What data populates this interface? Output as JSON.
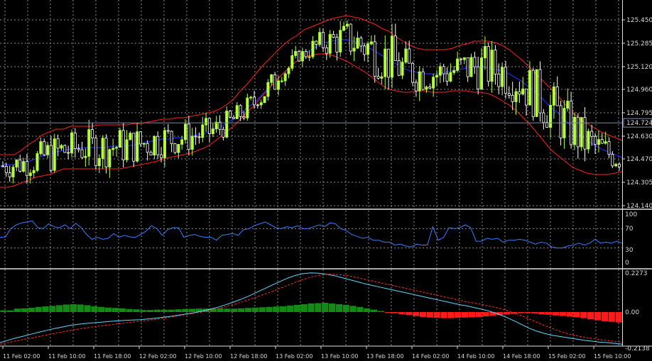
{
  "colors": {
    "background": "#000000",
    "grid": "#8a8a8a",
    "bull_candle": "#b5ff3a",
    "bear_candle": "#ffffff",
    "bb_upper": "#ff1e1e",
    "bb_middle": "#1a2dff",
    "bb_lower": "#ff1e1e",
    "rsi": "#3a7cff",
    "macd_pos_hist": "#138a13",
    "macd_neg_hist": "#ff1a1a",
    "macd_main": "#5fd8ff",
    "macd_signal": "#ff2a2a",
    "current_price_line": "#7a86c8"
  },
  "price_axis": {
    "ticks": [
      "125.450",
      "125.285",
      "125.120",
      "124.960",
      "124.795",
      "124.630",
      "124.470",
      "124.305",
      "124.140"
    ],
    "current_price_label": "124.724",
    "current_price": 124.724
  },
  "rsi_axis": {
    "ticks": [
      "100",
      "70",
      "30",
      "0"
    ]
  },
  "macd_axis": {
    "ticks": [
      "0.2273",
      "0.00",
      "-0.2138"
    ]
  },
  "time_axis": {
    "labels": [
      "11 Feb 02:00",
      "11 Feb 10:00",
      "11 Feb 18:00",
      "12 Feb 02:00",
      "12 Feb 10:00",
      "12 Feb 18:00",
      "13 Feb 02:00",
      "13 Feb 10:00",
      "13 Feb 18:00",
      "14 Feb 02:00",
      "14 Feb 10:00",
      "14 Feb 18:00",
      "15 Feb 02:00",
      "15 Feb 10:00"
    ]
  },
  "chart_data": [
    {
      "type": "candlestick",
      "title": "",
      "price_range": [
        124.14,
        125.53
      ],
      "bb_upper": [
        124.5,
        124.5,
        124.5,
        124.53,
        124.57,
        124.6,
        124.64,
        124.66,
        124.68,
        124.68,
        124.7,
        124.7,
        124.7,
        124.7,
        124.71,
        124.71,
        124.71,
        124.71,
        124.71,
        124.72,
        124.72,
        124.73,
        124.74,
        124.75,
        124.75,
        124.76,
        124.76,
        124.77,
        124.78,
        124.79,
        124.8,
        124.82,
        124.85,
        124.89,
        124.95,
        125.0,
        125.06,
        125.12,
        125.17,
        125.22,
        125.27,
        125.31,
        125.34,
        125.38,
        125.4,
        125.42,
        125.44,
        125.46,
        125.47,
        125.48,
        125.47,
        125.46,
        125.44,
        125.42,
        125.39,
        125.37,
        125.33,
        125.3,
        125.27,
        125.25,
        125.24,
        125.24,
        125.24,
        125.24,
        125.25,
        125.27,
        125.28,
        125.3,
        125.3,
        125.3,
        125.29,
        125.27,
        125.24,
        125.2,
        125.16,
        125.11,
        125.06,
        125.01,
        124.96,
        124.91,
        124.85,
        124.8,
        124.75,
        124.72,
        124.69,
        124.66,
        124.64,
        124.62,
        124.6
      ],
      "bb_middle": [
        124.42,
        124.43,
        124.43,
        124.44,
        124.45,
        124.47,
        124.49,
        124.5,
        124.52,
        124.53,
        124.54,
        124.55,
        124.55,
        124.55,
        124.55,
        124.55,
        124.56,
        124.56,
        124.56,
        124.57,
        124.58,
        124.59,
        124.6,
        124.61,
        124.61,
        124.62,
        124.62,
        124.63,
        124.64,
        124.65,
        124.67,
        124.69,
        124.72,
        124.75,
        124.79,
        124.83,
        124.87,
        124.92,
        124.97,
        125.02,
        125.07,
        125.12,
        125.16,
        125.2,
        125.24,
        125.27,
        125.29,
        125.3,
        125.31,
        125.31,
        125.3,
        125.28,
        125.26,
        125.23,
        125.2,
        125.17,
        125.14,
        125.11,
        125.09,
        125.08,
        125.07,
        125.07,
        125.07,
        125.08,
        125.09,
        125.1,
        125.11,
        125.12,
        125.12,
        125.11,
        125.1,
        125.09,
        125.07,
        125.04,
        125.01,
        124.97,
        124.93,
        124.88,
        124.83,
        124.79,
        124.74,
        124.69,
        124.64,
        124.6,
        124.57,
        124.54,
        124.52,
        124.5,
        124.48
      ],
      "bb_lower": [
        124.27,
        124.27,
        124.28,
        124.3,
        124.32,
        124.34,
        124.35,
        124.36,
        124.38,
        124.4,
        124.4,
        124.4,
        124.4,
        124.4,
        124.4,
        124.4,
        124.4,
        124.4,
        124.41,
        124.42,
        124.43,
        124.44,
        124.45,
        124.47,
        124.48,
        124.49,
        124.5,
        124.51,
        124.53,
        124.55,
        124.58,
        124.62,
        124.66,
        124.7,
        124.75,
        124.8,
        124.85,
        124.91,
        124.96,
        125.02,
        125.07,
        125.12,
        125.16,
        125.19,
        125.2,
        125.21,
        125.21,
        125.2,
        125.18,
        125.16,
        125.13,
        125.1,
        125.07,
        125.03,
        124.99,
        124.96,
        124.95,
        124.94,
        124.94,
        124.95,
        124.95,
        124.94,
        124.94,
        124.94,
        124.95,
        124.95,
        124.95,
        124.94,
        124.94,
        124.93,
        124.91,
        124.88,
        124.85,
        124.81,
        124.76,
        124.71,
        124.65,
        124.59,
        124.53,
        124.49,
        124.45,
        124.41,
        124.39,
        124.37,
        124.36,
        124.36,
        124.36,
        124.37,
        124.38
      ]
    },
    {
      "type": "line",
      "title": "",
      "ylim": [
        0,
        100
      ],
      "levels": [
        70,
        30
      ],
      "values": [
        52,
        53,
        70,
        78,
        82,
        84,
        86,
        72,
        70,
        80,
        74,
        72,
        78,
        70,
        81,
        72,
        58,
        48,
        52,
        48,
        50,
        60,
        52,
        56,
        53,
        52,
        58,
        65,
        76,
        70,
        56,
        68,
        72,
        72,
        52,
        56,
        58,
        54,
        52,
        52,
        46,
        56,
        58,
        60,
        56,
        68,
        70,
        76,
        80,
        84,
        78,
        72,
        70,
        74,
        72,
        76,
        70,
        70,
        74,
        78,
        74,
        82,
        80,
        70,
        66,
        58,
        54,
        50,
        52,
        46,
        46,
        42,
        42,
        36,
        38,
        34,
        32,
        38,
        36,
        36,
        74,
        46,
        52,
        72,
        70,
        72,
        78,
        72,
        44,
        44,
        50,
        48,
        50,
        42,
        46,
        46,
        48,
        46,
        42,
        38,
        42,
        40,
        32,
        30,
        30,
        34,
        36,
        40,
        36,
        40,
        48,
        40,
        42,
        40,
        44,
        40
      ]
    },
    {
      "type": "bar",
      "title": "",
      "ylim": [
        -0.2138,
        0.2273
      ],
      "histogram": [
        0.01,
        0.01,
        0.02,
        0.022,
        0.025,
        0.03,
        0.033,
        0.036,
        0.04,
        0.044,
        0.046,
        0.044,
        0.04,
        0.034,
        0.03,
        0.026,
        0.024,
        0.022,
        0.018,
        0.016,
        0.012,
        0.012,
        0.014,
        0.014,
        0.014,
        0.016,
        0.018,
        0.019,
        0.02,
        0.02,
        0.02,
        0.022,
        0.02,
        0.02,
        0.022,
        0.024,
        0.026,
        0.028,
        0.03,
        0.032,
        0.034,
        0.038,
        0.042,
        0.046,
        0.05,
        0.052,
        0.054,
        0.05,
        0.046,
        0.042,
        0.036,
        0.03,
        0.022,
        0.014,
        0.006,
        -0.002,
        -0.008,
        -0.014,
        -0.02,
        -0.026,
        -0.032,
        -0.036,
        -0.038,
        -0.04,
        -0.04,
        -0.038,
        -0.036,
        -0.034,
        -0.032,
        -0.028,
        -0.024,
        -0.02,
        -0.016,
        -0.012,
        -0.008,
        -0.008,
        -0.01,
        -0.014,
        -0.018,
        -0.022,
        -0.026,
        -0.03,
        -0.034,
        -0.04,
        -0.048,
        -0.054,
        -0.06,
        -0.064,
        -0.068
      ],
      "series": [
        {
          "values": [
            -0.2,
            -0.185,
            -0.17,
            -0.158,
            -0.145,
            -0.132,
            -0.12,
            -0.108,
            -0.098,
            -0.088,
            -0.08,
            -0.075,
            -0.07,
            -0.066,
            -0.062,
            -0.058,
            -0.055,
            -0.052,
            -0.05,
            -0.045,
            -0.04,
            -0.034,
            -0.028,
            -0.02,
            -0.012,
            -0.004,
            0.006,
            0.016,
            0.028,
            0.042,
            0.058,
            0.075,
            0.094,
            0.115,
            0.136,
            0.158,
            0.178,
            0.198,
            0.214,
            0.224,
            0.228,
            0.226,
            0.22,
            0.212,
            0.2,
            0.188,
            0.176,
            0.164,
            0.154,
            0.144,
            0.134,
            0.124,
            0.114,
            0.104,
            0.094,
            0.084,
            0.074,
            0.064,
            0.054,
            0.044,
            0.036,
            0.026,
            0.016,
            0.004,
            -0.012,
            -0.032,
            -0.055,
            -0.08,
            -0.105,
            -0.125,
            -0.14,
            -0.152,
            -0.16,
            -0.168,
            -0.176,
            -0.184,
            -0.19,
            -0.196,
            -0.2,
            -0.205,
            -0.21
          ]
        },
        {
          "values": [
            -0.21,
            -0.2,
            -0.19,
            -0.18,
            -0.17,
            -0.16,
            -0.15,
            -0.14,
            -0.13,
            -0.12,
            -0.112,
            -0.104,
            -0.097,
            -0.09,
            -0.084,
            -0.078,
            -0.072,
            -0.066,
            -0.06,
            -0.054,
            -0.048,
            -0.04,
            -0.032,
            -0.024,
            -0.016,
            -0.008,
            0.0,
            0.01,
            0.02,
            0.032,
            0.044,
            0.058,
            0.072,
            0.088,
            0.104,
            0.12,
            0.138,
            0.156,
            0.174,
            0.19,
            0.204,
            0.214,
            0.22,
            0.22,
            0.216,
            0.21,
            0.2,
            0.19,
            0.18,
            0.17,
            0.16,
            0.15,
            0.14,
            0.13,
            0.12,
            0.11,
            0.1,
            0.09,
            0.08,
            0.07,
            0.06,
            0.052,
            0.044,
            0.034,
            0.024,
            0.012,
            -0.004,
            -0.022,
            -0.044,
            -0.066,
            -0.088,
            -0.108,
            -0.126,
            -0.142,
            -0.154,
            -0.164,
            -0.172,
            -0.18,
            -0.186,
            -0.192,
            -0.198
          ]
        }
      ]
    }
  ]
}
